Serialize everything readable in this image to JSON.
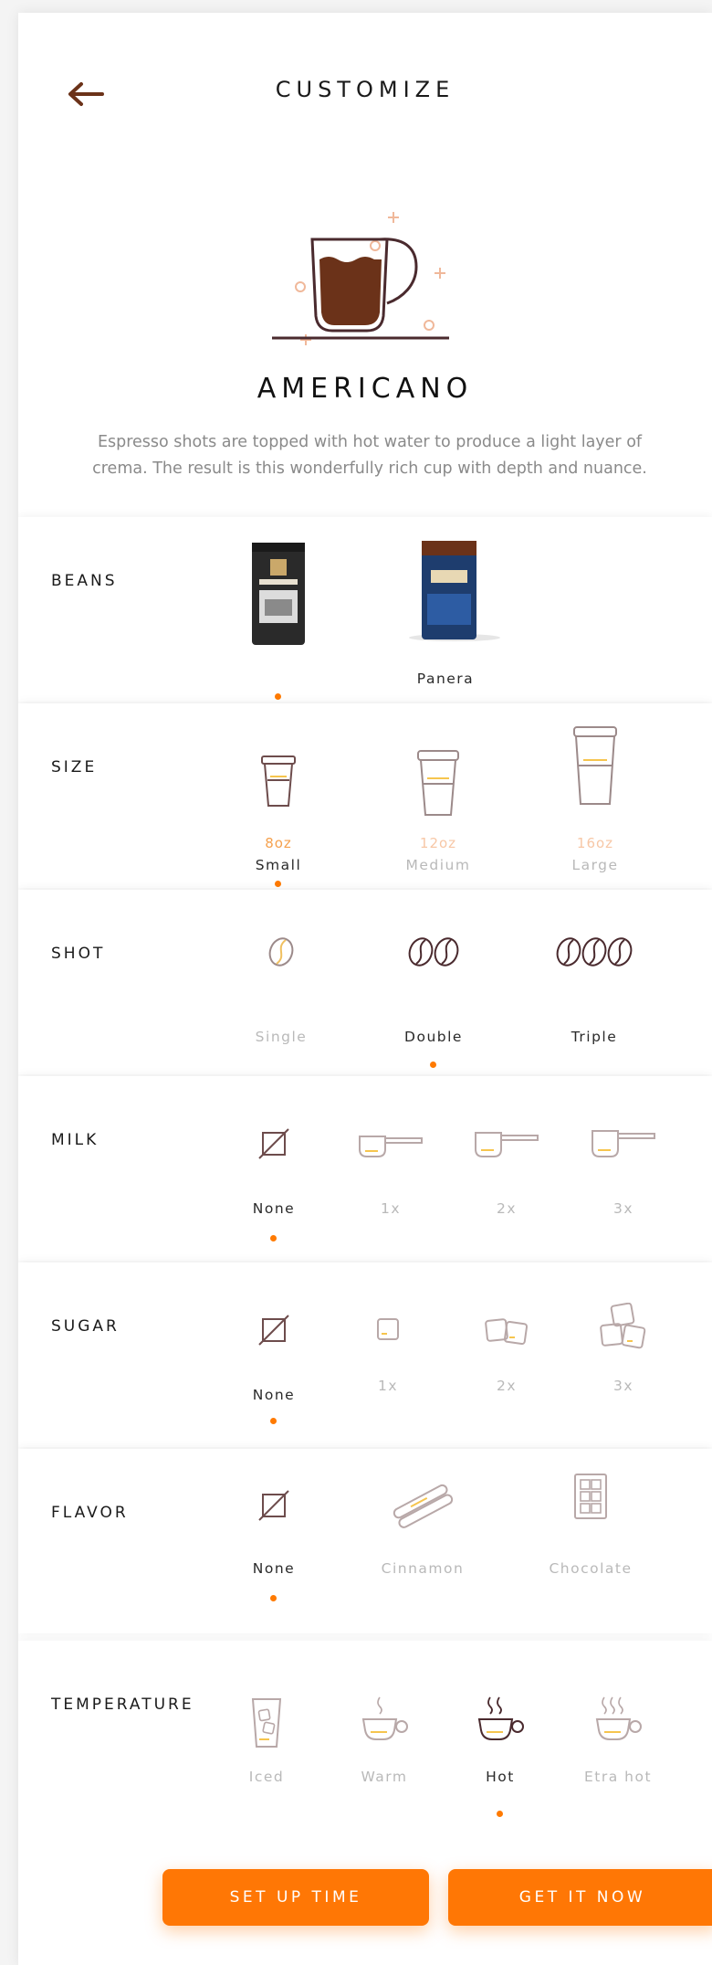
{
  "header": {
    "title": "CUSTOMIZE"
  },
  "product": {
    "name": "AMERICANO",
    "description_line1": "Espresso shots are topped with hot water to produce a light layer of",
    "description_line2": "crema. The result is this wonderfully rich cup with depth and nuance."
  },
  "beans": {
    "label": "BEANS",
    "options": [
      {
        "name": "",
        "selected": true
      },
      {
        "name": "Panera",
        "selected": false
      }
    ]
  },
  "size": {
    "label": "SIZE",
    "options": [
      {
        "oz": "8oz",
        "name": "Small",
        "selected": true
      },
      {
        "oz": "12oz",
        "name": "Medium",
        "selected": false
      },
      {
        "oz": "16oz",
        "name": "Large",
        "selected": false
      }
    ]
  },
  "shot": {
    "label": "SHOT",
    "options": [
      {
        "name": "Single",
        "selected": false
      },
      {
        "name": "Double",
        "selected": true
      },
      {
        "name": "Triple",
        "selected": false
      }
    ]
  },
  "milk": {
    "label": "MILK",
    "options": [
      {
        "name": "None",
        "selected": true
      },
      {
        "name": "1x",
        "selected": false
      },
      {
        "name": "2x",
        "selected": false
      },
      {
        "name": "3x",
        "selected": false
      }
    ]
  },
  "sugar": {
    "label": "SUGAR",
    "options": [
      {
        "name": "None",
        "selected": true
      },
      {
        "name": "1x",
        "selected": false
      },
      {
        "name": "2x",
        "selected": false
      },
      {
        "name": "3x",
        "selected": false
      }
    ]
  },
  "flavor": {
    "label": "FLAVOR",
    "options": [
      {
        "name": "None",
        "selected": true
      },
      {
        "name": "Cinnamon",
        "selected": false
      },
      {
        "name": "Chocolate",
        "selected": false
      }
    ]
  },
  "temperature": {
    "label": "TEMPERATURE",
    "options": [
      {
        "name": "Iced",
        "selected": false
      },
      {
        "name": "Warm",
        "selected": false
      },
      {
        "name": "Hot",
        "selected": true
      },
      {
        "name": "Etra hot",
        "selected": false
      }
    ]
  },
  "buttons": {
    "setup_time": "SET UP TIME",
    "get_now": "GET IT NOW"
  },
  "colors": {
    "accent": "#ff7705",
    "coffee": "#6b3219",
    "icon_stroke": "#6d4c4c",
    "muted_text": "#b9b9b9"
  },
  "icons": {
    "back": "arrow-left-icon",
    "beans_1": "coffee-bag-peets-icon",
    "beans_2": "coffee-bag-panera-icon",
    "none": "none-slash-icon",
    "milk": "measuring-scoop-icon",
    "sugar": "sugar-cube-icon",
    "cinnamon": "cinnamon-stick-icon",
    "chocolate": "chocolate-bar-icon",
    "iced": "iced-glass-icon",
    "cup": "steaming-cup-icon"
  }
}
